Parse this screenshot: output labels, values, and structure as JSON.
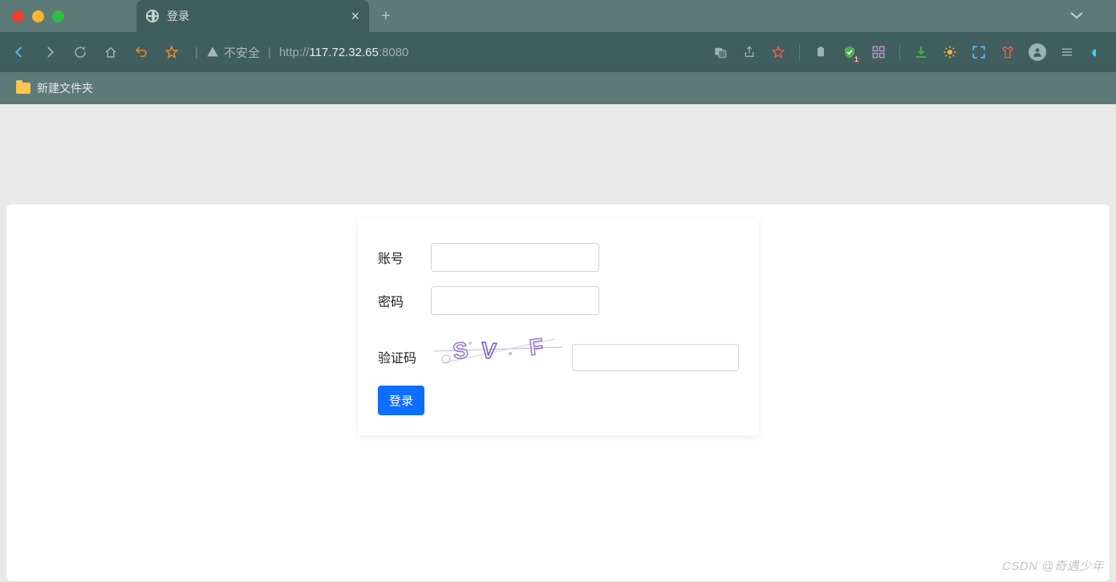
{
  "browser": {
    "tab_title": "登录",
    "security_label": "不安全",
    "url_protocol": "http://",
    "url_host": "117.72.32.65",
    "url_port": ":8080",
    "bookmark_folder": "新建文件夹",
    "shield_badge": "1"
  },
  "login": {
    "account_label": "账号",
    "password_label": "密码",
    "captcha_label": "验证码",
    "captcha_text": "SVF",
    "submit_label": "登录"
  },
  "watermark": "CSDN @奇遇少年"
}
